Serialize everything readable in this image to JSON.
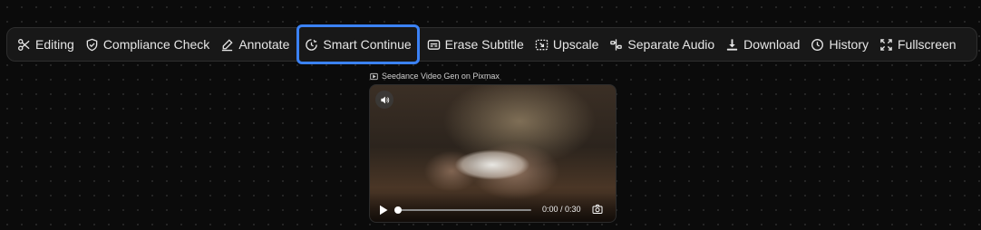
{
  "toolbar": {
    "items": [
      {
        "label": "Editing",
        "icon": "scissors-icon"
      },
      {
        "label": "Compliance Check",
        "icon": "shield-check-icon"
      },
      {
        "label": "Annotate",
        "icon": "pen-icon"
      },
      {
        "label": "Smart Continue",
        "icon": "clock-continue-icon",
        "highlighted": true
      },
      {
        "label": "Erase Subtitle",
        "icon": "subtitle-icon"
      },
      {
        "label": "Upscale",
        "icon": "upscale-icon"
      },
      {
        "label": "Separate Audio",
        "icon": "separate-icon"
      },
      {
        "label": "Download",
        "icon": "download-icon"
      },
      {
        "label": "History",
        "icon": "history-icon"
      },
      {
        "label": "Fullscreen",
        "icon": "fullscreen-icon"
      }
    ],
    "highlight_color": "#3b82f6"
  },
  "video": {
    "caption": "Seedance Video Gen on Pixmax",
    "time": "0:00 / 0:30",
    "progress": 0
  }
}
